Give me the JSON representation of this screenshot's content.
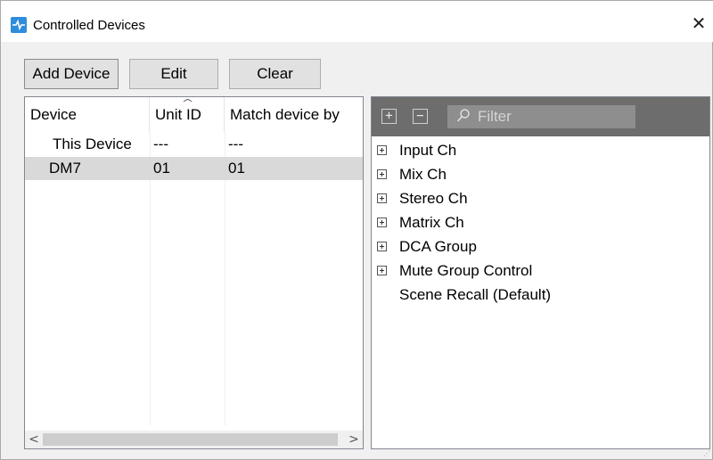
{
  "window": {
    "title": "Controlled Devices",
    "close_glyph": "✕"
  },
  "toolbar": {
    "add_device_label": "Add Device",
    "edit_label": "Edit",
    "clear_label": "Clear"
  },
  "device_list": {
    "columns": [
      "Device",
      "Unit ID",
      "Match device by"
    ],
    "sorted_column": "Unit ID",
    "rows": [
      {
        "device": "This Device",
        "unit_id": "---",
        "match": "---",
        "selected": false
      },
      {
        "device": "DM7",
        "unit_id": "01",
        "match": "01",
        "selected": true
      }
    ],
    "scroll_left_glyph": "<",
    "scroll_right_glyph": ">"
  },
  "parameter_tree": {
    "expand_all_glyph": "+",
    "collapse_all_glyph": "−",
    "filter_placeholder": "Filter",
    "items": [
      {
        "label": "Input Ch",
        "expandable": true
      },
      {
        "label": "Mix Ch",
        "expandable": true
      },
      {
        "label": "Stereo Ch",
        "expandable": true
      },
      {
        "label": "Matrix Ch",
        "expandable": true
      },
      {
        "label": "DCA Group",
        "expandable": true
      },
      {
        "label": "Mute Group Control",
        "expandable": true
      },
      {
        "label": "Scene Recall (Default)",
        "expandable": false
      }
    ]
  },
  "colors": {
    "app_icon": "#2f8cdb",
    "toolbar_bg": "#6d6d6d",
    "selected_row": "#d9d9d9"
  }
}
